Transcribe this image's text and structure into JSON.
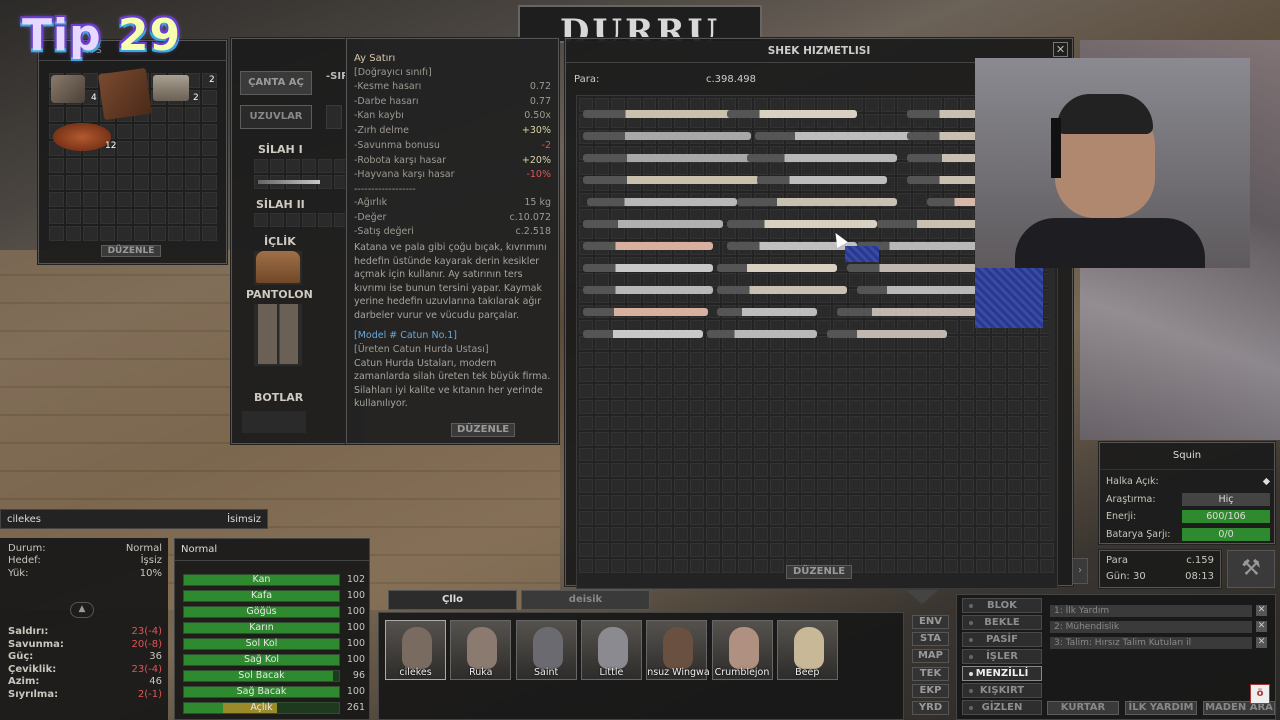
{
  "overlay": {
    "tip_word": "Tip",
    "tip_number": "29"
  },
  "backpack": {
    "title_fragment": "A S",
    "title_fragment2": "A",
    "edit_label": "DÜZENLE",
    "items": [
      {
        "count": "4"
      },
      {
        "count": ""
      },
      {
        "count": "2"
      },
      {
        "count": "2"
      },
      {
        "count": "12"
      }
    ]
  },
  "equipment": {
    "open_bag_label": "ÇANTA AÇ",
    "experts_label": "UZUVLAR",
    "title_fragment": "-SIR",
    "slots": {
      "weapon1": "SİLAH I",
      "weapon2": "SİLAH II",
      "shirt": "İÇLİK",
      "pants": "PANTOLON",
      "boots": "BOTLAR"
    }
  },
  "tooltip": {
    "name": "Ay Satırı",
    "class": "[Doğrayıcı sınıfı]",
    "stats": [
      {
        "label": "-Kesme hasarı",
        "value": "0.72",
        "tone": "normal"
      },
      {
        "label": "-Darbe hasarı",
        "value": "0.77",
        "tone": "normal"
      },
      {
        "label": "-Kan kaybı",
        "value": "0.50x",
        "tone": "normal"
      },
      {
        "label": "-Zırh delme",
        "value": "+30%",
        "tone": "pos"
      },
      {
        "label": "-Savunma bonusu",
        "value": "-2",
        "tone": "neg"
      },
      {
        "label": "-Robota karşı hasar",
        "value": "+20%",
        "tone": "pos"
      },
      {
        "label": "-Hayvana karşı hasar",
        "value": "-10%",
        "tone": "neg"
      }
    ],
    "separator": "------------------",
    "props": [
      {
        "label": "-Ağırlık",
        "value": "15 kg"
      },
      {
        "label": "-Değer",
        "value": "c.10.072"
      },
      {
        "label": "-Satış değeri",
        "value": "c.2.518"
      }
    ],
    "description": "Katana ve pala gibi çoğu bıçak, kıvrımını hedefin üstünde kayarak derin kesikler açmak için kullanır. Ay satırının ters kıvrımı ise bunun tersini yapar. Kaymak yerine hedefin uzuvlarına takılarak ağır darbeler vurur ve vücudu parçalar.",
    "model": "[Model # Catun No.1]",
    "maker": "[Üreten Catun Hurda Ustası]",
    "maker_desc": "Catun Hurda Ustaları, modern zamanlarda silah üreten tek büyük firma. Silahları iyi kalite ve kıtanın her yerinde kullanılıyor.",
    "edit_label": "DÜZENLE"
  },
  "shop": {
    "sign": "DURRU",
    "title": "SHEK HIZMETLISI",
    "money_label": "Para:",
    "money_value": "c.398.498",
    "edit_label": "DÜZENLE"
  },
  "squad_info": {
    "title": "Squin",
    "rows": [
      {
        "label": "Halka Açık:",
        "value": "◆",
        "bar": false
      },
      {
        "label": "Araştırma:",
        "value": "Hiç",
        "bar": false
      },
      {
        "label": "Enerji:",
        "value": "600/106",
        "bar": true
      },
      {
        "label": "Batarya Şarjı:",
        "value": "0/0",
        "bar": true
      }
    ]
  },
  "money_box": {
    "label": "Para",
    "value": "c.159",
    "day_label": "Gün: 30",
    "time": "08:13"
  },
  "character": {
    "name": "cilekes",
    "faction": "İsimsiz",
    "status": [
      {
        "label": "Durum:",
        "value": "Normal"
      },
      {
        "label": "Hedef:",
        "value": "İşsiz"
      },
      {
        "label": "Yük:",
        "value": "10%"
      }
    ],
    "skills": [
      {
        "label": "Saldırı:",
        "value": "23(-4)",
        "neg": true
      },
      {
        "label": "Savunma:",
        "value": "20(-8)",
        "neg": true
      },
      {
        "label": "Güç:",
        "value": "36",
        "neg": false
      },
      {
        "label": "Çeviklik:",
        "value": "23(-4)",
        "neg": true
      },
      {
        "label": "Azim:",
        "value": "46",
        "neg": false
      },
      {
        "label": "Sıyrılma:",
        "value": "2(-1)",
        "neg": true
      }
    ],
    "health_state": "Normal",
    "health": [
      {
        "name": "Kan",
        "value": "102",
        "fill": 1.0
      },
      {
        "name": "Kafa",
        "value": "100",
        "fill": 1.0
      },
      {
        "name": "Göğüs",
        "value": "100",
        "fill": 1.0
      },
      {
        "name": "Karın",
        "value": "100",
        "fill": 1.0
      },
      {
        "name": "Sol Kol",
        "value": "100",
        "fill": 1.0
      },
      {
        "name": "Sağ Kol",
        "value": "100",
        "fill": 1.0
      },
      {
        "name": "Sol Bacak",
        "value": "96",
        "fill": 0.96
      },
      {
        "name": "Sağ Bacak",
        "value": "100",
        "fill": 1.0
      },
      {
        "name": "Açlık",
        "value": "261",
        "fill": 0.6
      }
    ]
  },
  "squad_tabs": {
    "tab1": "Çllo",
    "tab2": "deisik"
  },
  "portraits": [
    "cilekes",
    "Ruka",
    "Saint",
    "Little",
    "nsuz Wingwa",
    "Crumblejon",
    "Beep"
  ],
  "side_menu": [
    "ENV",
    "STA",
    "MAP",
    "TEK",
    "EKP",
    "YRD"
  ],
  "actions": [
    "BLOK",
    "BEKLE",
    "PASİF",
    "İŞLER",
    "MENZİLLİ",
    "KIŞKIRT",
    "GİZLEN"
  ],
  "jobs": [
    "1: İlk Yardım",
    "2: Mühendislik",
    "3: Talim: Hırsız Talim Kutuları il"
  ],
  "bottom_buttons": [
    "KURTAR",
    "İLK YARDIM",
    "MADEN ARA"
  ]
}
